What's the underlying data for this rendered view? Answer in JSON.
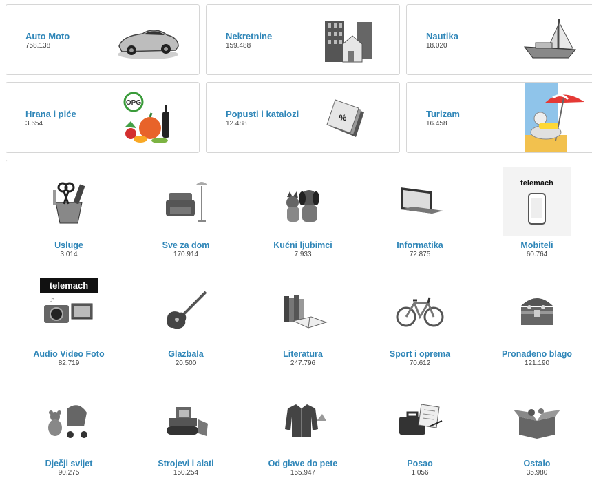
{
  "featured": [
    {
      "title": "Auto Moto",
      "count": "758.138",
      "icon": "sports-car-icon"
    },
    {
      "title": "Nekretnine",
      "count": "159.488",
      "icon": "buildings-icon"
    },
    {
      "title": "Nautika",
      "count": "18.020",
      "icon": "sailboat-icon"
    },
    {
      "title": "Hrana i piće",
      "count": "3.654",
      "icon": "food-icon",
      "badge": "OPG"
    },
    {
      "title": "Popusti i katalozi",
      "count": "12.488",
      "icon": "discount-tags-icon",
      "badge": "%"
    },
    {
      "title": "Turizam",
      "count": "16.458",
      "icon": "beach-umbrella-icon"
    }
  ],
  "categories": [
    {
      "title": "Usluge",
      "count": "3.014",
      "icon": "tools-cup-icon"
    },
    {
      "title": "Sve za dom",
      "count": "170.914",
      "icon": "armchair-lamp-icon"
    },
    {
      "title": "Kućni ljubimci",
      "count": "7.933",
      "icon": "cat-dog-icon"
    },
    {
      "title": "Informatika",
      "count": "72.875",
      "icon": "laptop-icon"
    },
    {
      "title": "Mobiteli",
      "count": "60.764",
      "icon": "smartphone-icon",
      "brand": "telemach"
    },
    {
      "title": "Audio Video Foto",
      "count": "82.719",
      "icon": "camera-tv-icon",
      "brand": "telemach"
    },
    {
      "title": "Glazbala",
      "count": "20.500",
      "icon": "electric-guitar-icon"
    },
    {
      "title": "Literatura",
      "count": "247.796",
      "icon": "books-icon"
    },
    {
      "title": "Sport i oprema",
      "count": "70.612",
      "icon": "bicycle-icon"
    },
    {
      "title": "Pronađeno blago",
      "count": "121.190",
      "icon": "treasure-chest-icon"
    },
    {
      "title": "Dječji svijet",
      "count": "90.275",
      "icon": "stroller-teddy-icon"
    },
    {
      "title": "Strojevi i alati",
      "count": "150.254",
      "icon": "bulldozer-icon"
    },
    {
      "title": "Od glave do pete",
      "count": "155.947",
      "icon": "jacket-icon"
    },
    {
      "title": "Posao",
      "count": "1.056",
      "icon": "briefcase-icon"
    },
    {
      "title": "Ostalo",
      "count": "35.980",
      "icon": "open-box-icon"
    }
  ],
  "colors": {
    "link": "#2f86b8",
    "count": "#444444",
    "border": "#d6d6d6"
  }
}
